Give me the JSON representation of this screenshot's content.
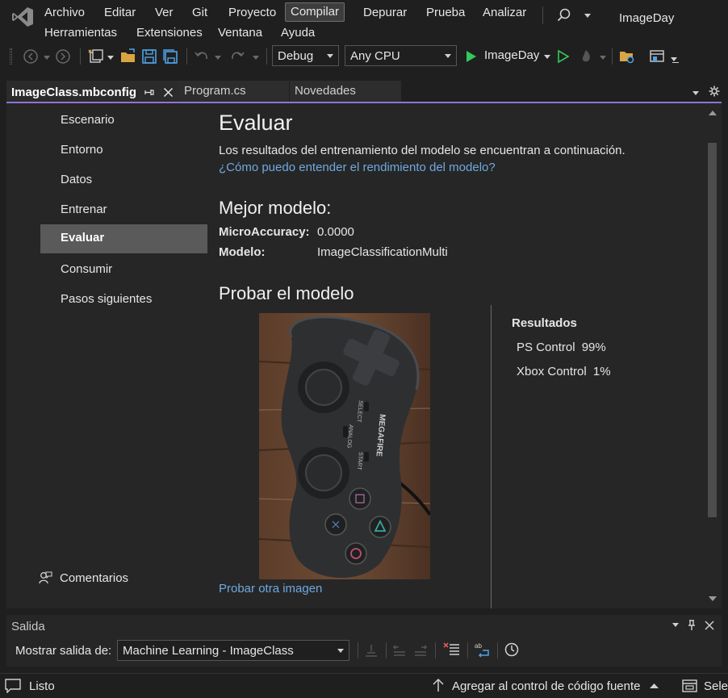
{
  "menu": {
    "items": [
      "Archivo",
      "Editar",
      "Ver",
      "Git",
      "Proyecto",
      "Compilar",
      "Depurar",
      "Prueba",
      "Analizar"
    ],
    "items_row2": [
      "Herramientas",
      "Extensiones",
      "Ventana",
      "Ayuda"
    ],
    "active_item": "Compilar",
    "app_title": "ImageDay"
  },
  "toolbar": {
    "configuration": "Debug",
    "platform": "Any CPU",
    "run_target": "ImageDay"
  },
  "tabs": [
    {
      "label": "ImageClass.mbconfig",
      "active": true
    },
    {
      "label": "Program.cs",
      "active": false
    },
    {
      "label": "Novedades",
      "active": false
    }
  ],
  "nav": {
    "items": [
      "Escenario",
      "Entorno",
      "Datos",
      "Entrenar",
      "Evaluar",
      "Consumir",
      "Pasos siguientes"
    ],
    "selected": "Evaluar",
    "feedback": "Comentarios"
  },
  "main": {
    "title": "Evaluar",
    "description": "Los resultados del entrenamiento del modelo se encuentran a continuación.",
    "help_link": "¿Cómo puedo entender el rendimiento del modelo?",
    "best_model_title": "Mejor modelo:",
    "metric_label": "MicroAccuracy:",
    "metric_value": "0.0000",
    "model_label": "Modelo:",
    "model_value": "ImageClassificationMulti",
    "test_title": "Probar el modelo",
    "try_another": "Probar otra imagen",
    "image_text": {
      "brand": "MEGAFIRE",
      "select": "SELECT",
      "analog": "ANALOG",
      "start": "START"
    },
    "results_title": "Resultados",
    "results": [
      {
        "label": "PS Control",
        "value": "99%"
      },
      {
        "label": "Xbox Control",
        "value": "1%"
      }
    ]
  },
  "output": {
    "title": "Salida",
    "show_from_label": "Mostrar salida de:",
    "source": "Machine Learning - ImageClass"
  },
  "status": {
    "state": "Listo",
    "source_control": "Agregar al control de código fuente",
    "select_repo": "Selec"
  },
  "colors": {
    "accent": "#8f73d8",
    "link": "#6fa9e0",
    "run_green": "#34c759"
  }
}
